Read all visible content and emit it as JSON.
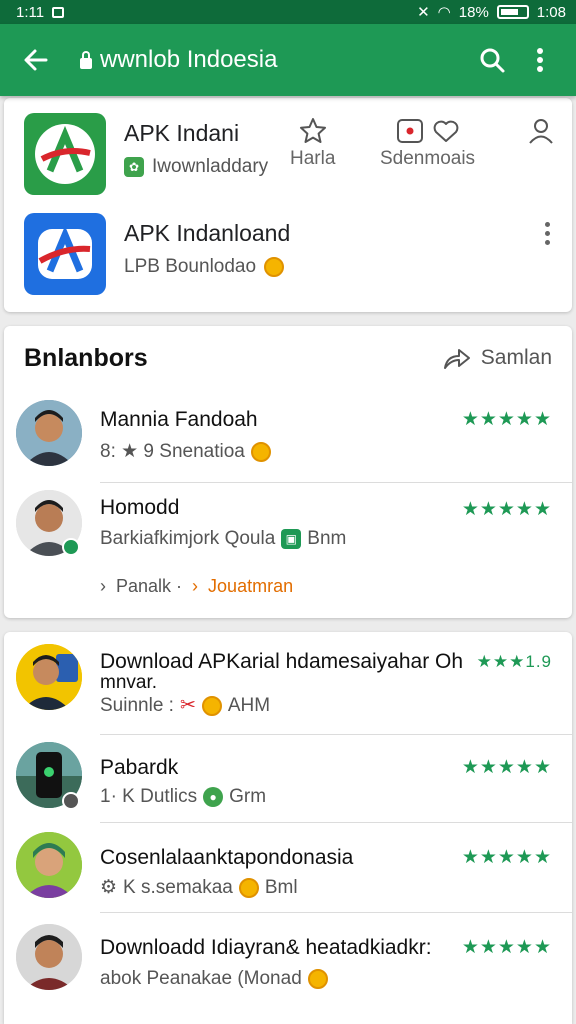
{
  "status_bar": {
    "time_left": "1:11",
    "battery": "18%",
    "time_right": "1:08"
  },
  "toolbar": {
    "back_icon": "arrow-left-icon",
    "title": "wwnlob Indoesia",
    "search_icon": "search-icon",
    "menu_icon": "kebab-icon"
  },
  "apps": [
    {
      "name": "APK Indani",
      "sub": "Iwownladdary",
      "icon": "app-logo-green"
    },
    {
      "name": "APK Indanloand",
      "sub": "LPB Bounlodao",
      "icon": "app-logo-blue"
    }
  ],
  "actions": [
    {
      "label": "Harla",
      "icon": "star-outline-icon"
    },
    {
      "label": "Sdenmoais",
      "icon": "heart-badge-icon"
    },
    {
      "label": "",
      "icon": "person-icon"
    }
  ],
  "reviewers": {
    "title": "Bnlanbors",
    "share_label": "Samlan",
    "items": [
      {
        "name": "Mannia Fandoah",
        "sub": "8: ★ 9 Snenatioa",
        "stars": "★★★★★"
      },
      {
        "name": "Homodd",
        "sub": "Barkiafkimjork Qoula",
        "sub_extra": "Bnm",
        "stars": "★★★★★"
      }
    ],
    "more": {
      "left": "Panalk ·",
      "right": "Jouatmran"
    }
  },
  "downloads": [
    {
      "name": "Download APKarial hdamesaiyahar Oh",
      "name2": "mnvar.",
      "sub": "Suinnle :",
      "sub_extra": "AHM",
      "stars": "★★★1.9"
    },
    {
      "name": "Pabardk",
      "sub": "1· K Dutlics",
      "sub_extra": "Grm",
      "stars": "★★★★★"
    },
    {
      "name": "Cosenlalaanktapondonasia",
      "sub": "K s.semakaa",
      "sub_extra": "Bml",
      "stars": "★★★★★"
    },
    {
      "name": "Downloadd Idiayran& heatadkiadkr:",
      "sub": "abok Peanakae (Monad",
      "stars": "★★★★★"
    }
  ],
  "colors": {
    "primary": "#1e9955",
    "status": "#0e6b3a",
    "accent": "#e26d00"
  }
}
